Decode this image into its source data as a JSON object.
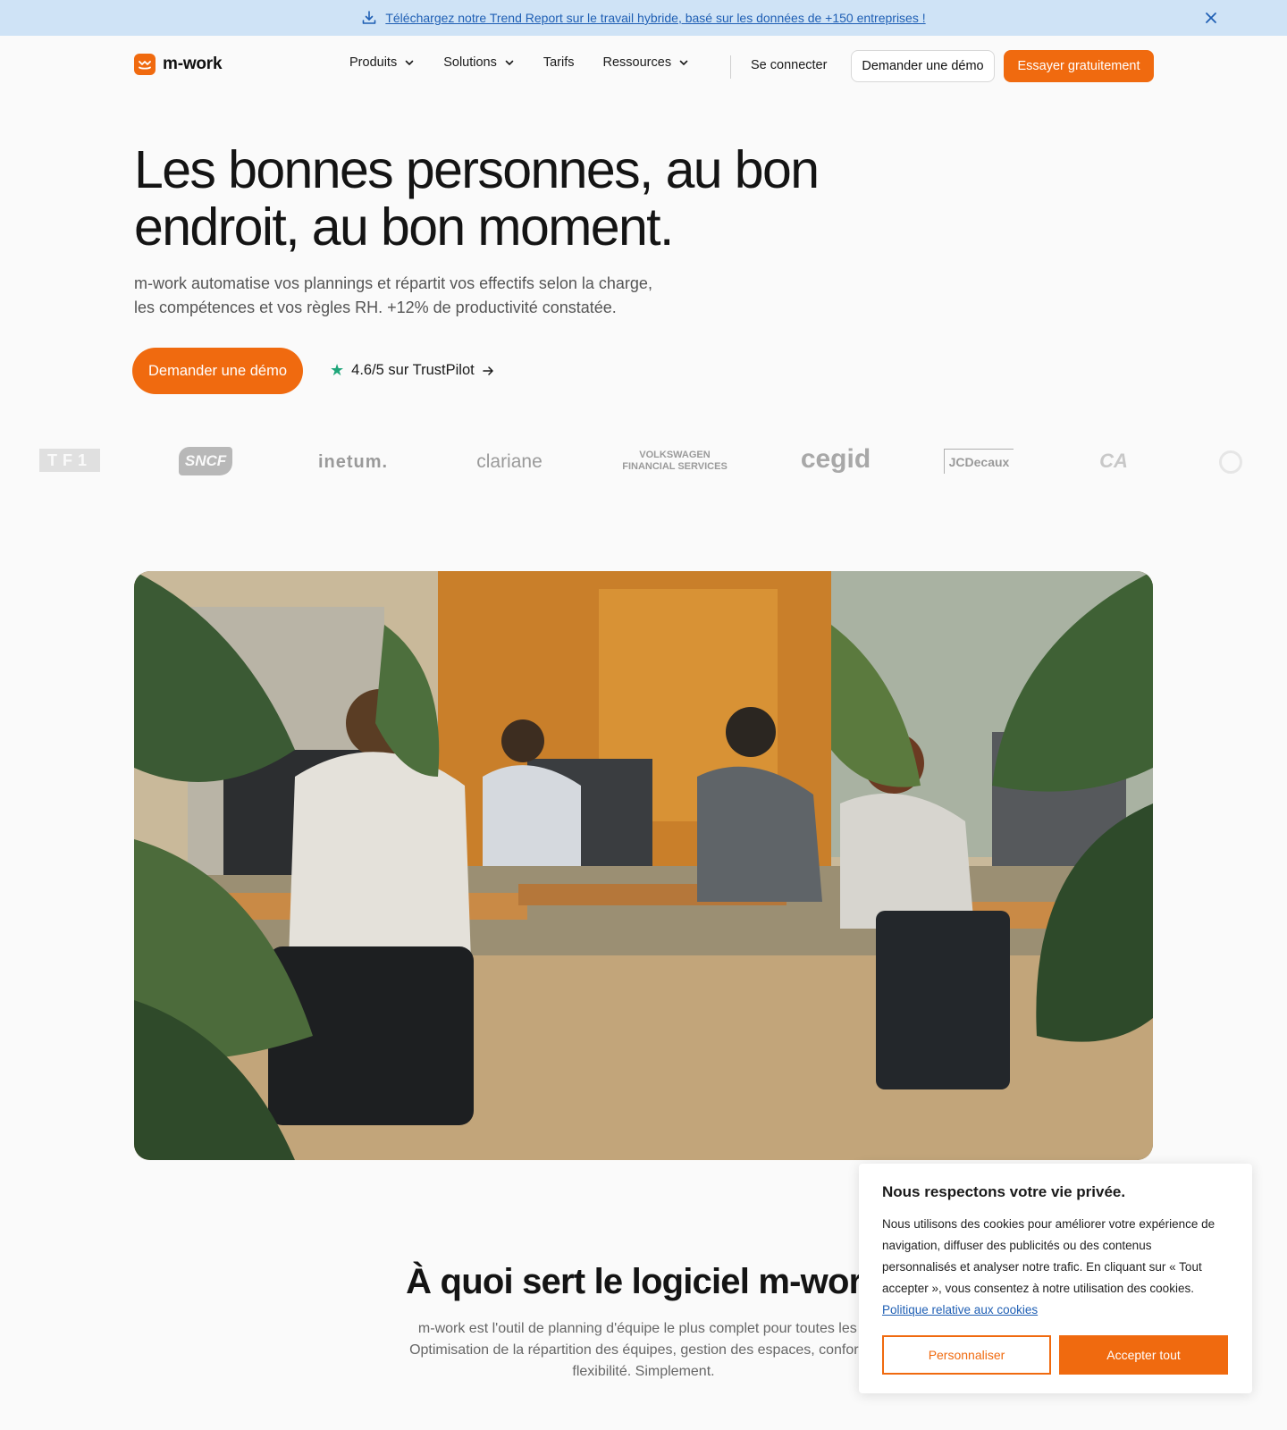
{
  "colors": {
    "accent": "#f06a0f",
    "banner_bg": "#cfe3f6",
    "link": "#1f5fb4",
    "trust_star": "#1fa67a"
  },
  "banner": {
    "text": "Téléchargez notre Trend Report sur le travail hybride, basé sur les données de +150 entreprises !",
    "download_icon": "download-icon",
    "close_icon": "close-icon"
  },
  "nav": {
    "logo_text": "m-work",
    "items": [
      {
        "label": "Produits",
        "dropdown": true
      },
      {
        "label": "Solutions",
        "dropdown": true
      },
      {
        "label": "Tarifs",
        "dropdown": false
      },
      {
        "label": "Ressources",
        "dropdown": true
      }
    ],
    "login": "Se connecter",
    "demo": "Demander une démo",
    "try": "Essayer gratuitement"
  },
  "hero": {
    "title": "Les bonnes personnes, au bon endroit, au bon moment.",
    "subtitle_line1": "m-work automatise vos plannings et répartit vos effectifs selon la charge,",
    "subtitle_line2": "les compétences et vos règles RH. +12% de productivité constatée.",
    "cta": "Demander une démo",
    "trust": "4.6/5 sur TrustPilot",
    "trust_icon": "star-icon"
  },
  "logos": {
    "tf1": "TF1",
    "sncf": "SNCF",
    "inetum": "inetum.",
    "clariane": "clariane",
    "vw_line1": "VOLKSWAGEN",
    "vw_line2": "FINANCIAL SERVICES",
    "cegid": "cegid",
    "jcdecaux": "JCDecaux",
    "ca": "CA"
  },
  "section": {
    "title": "À quoi sert le logiciel m-work",
    "sub_line1": "m-work est l'outil de planning d'équipe le plus complet pour toutes les é",
    "sub_line2": "Optimisation de la répartition des équipes, gestion des espaces, conformit",
    "sub_line3": "flexibilité. Simplement."
  },
  "cookie": {
    "title": "Nous respectons votre vie privée.",
    "body": "Nous utilisons des cookies pour améliorer votre expérience de navigation, diffuser des publicités ou des contenus personnalisés et analyser notre trafic. En cliquant sur « Tout accepter », vous consentez à notre utilisation des cookies.",
    "link": "Politique relative aux cookies",
    "customize": "Personnaliser",
    "accept": "Accepter tout"
  }
}
